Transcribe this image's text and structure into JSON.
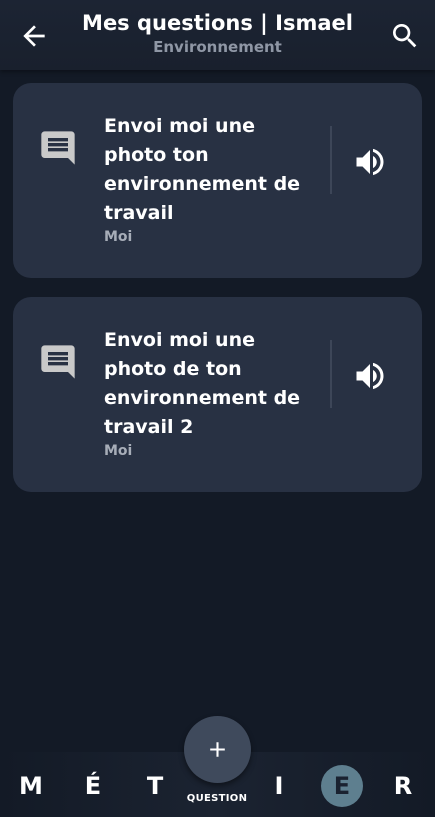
{
  "header": {
    "title": "Mes questions | Ismael",
    "subtitle": "Environnement",
    "back_icon": "arrow-left-icon",
    "search_icon": "search-icon"
  },
  "questions": [
    {
      "text": "Envoi moi une photo ton environnement de travail",
      "author": "Moi",
      "icon": "chat-message-icon",
      "audio_icon": "volume-icon"
    },
    {
      "text": "Envoi moi une photo de ton environnement de travail 2",
      "author": "Moi",
      "icon": "chat-message-icon",
      "audio_icon": "volume-icon"
    }
  ],
  "bottom_nav": {
    "letters": [
      "M",
      "É",
      "T",
      "I",
      "E",
      "R"
    ],
    "active_letter": "E",
    "fab_label": "QUESTION",
    "fab_icon": "plus-icon"
  },
  "colors": {
    "background": "#131a26",
    "card": "#283143",
    "active_letter_bg": "#5e7f8f",
    "subtitle": "#8f97a5"
  }
}
